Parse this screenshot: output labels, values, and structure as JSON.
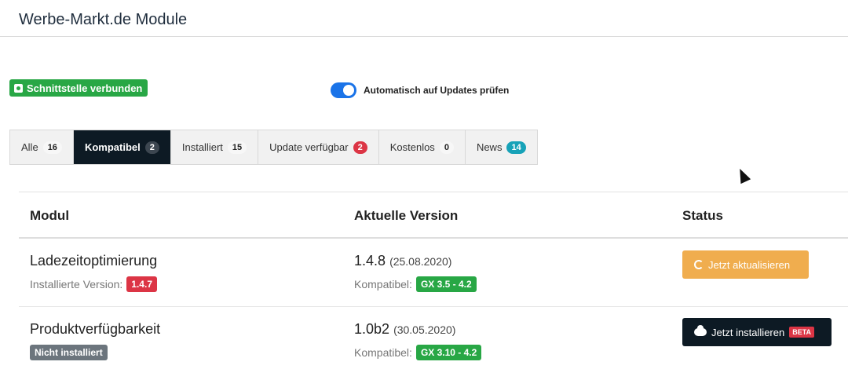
{
  "header": {
    "title": "Werbe-Markt.de Module"
  },
  "connection": {
    "label": "Schnittstelle verbunden",
    "icon": "share-icon",
    "color": "#28a745"
  },
  "auto_update": {
    "label": "Automatisch auf Updates prüfen",
    "enabled": true
  },
  "tabs": [
    {
      "label": "Alle",
      "count": "16",
      "active": false
    },
    {
      "label": "Kompatibel",
      "count": "2",
      "active": true
    },
    {
      "label": "Installiert",
      "count": "15",
      "active": false
    },
    {
      "label": "Update verfügbar",
      "count": "2",
      "active": false,
      "badge_color": "#dc3545"
    },
    {
      "label": "Kostenlos",
      "count": "0",
      "active": false
    },
    {
      "label": "News",
      "count": "14",
      "active": false,
      "badge_color": "#17a2b8"
    }
  ],
  "table": {
    "columns": [
      "Modul",
      "Aktuelle Version",
      "Status"
    ],
    "rows": [
      {
        "name": "Ladezeitoptimierung",
        "installed_label": "Installierte Version:",
        "installed_version": "1.4.7",
        "version": "1.4.8",
        "date": "(25.08.2020)",
        "compat_label": "Kompatibel:",
        "compat": "GX 3.5 - 4.2",
        "action": "Jetzt aktualisieren",
        "action_icon": "refresh-icon"
      },
      {
        "name": "Produktverfügbarkeit",
        "installed_badge": "Nicht installiert",
        "version": "1.0b2",
        "date": "(30.05.2020)",
        "compat_label": "Kompatibel:",
        "compat": "GX 3.10 - 4.2",
        "action": "Jetzt installieren",
        "action_icon": "cloud-download-icon",
        "action_badge": "BETA"
      }
    ]
  }
}
